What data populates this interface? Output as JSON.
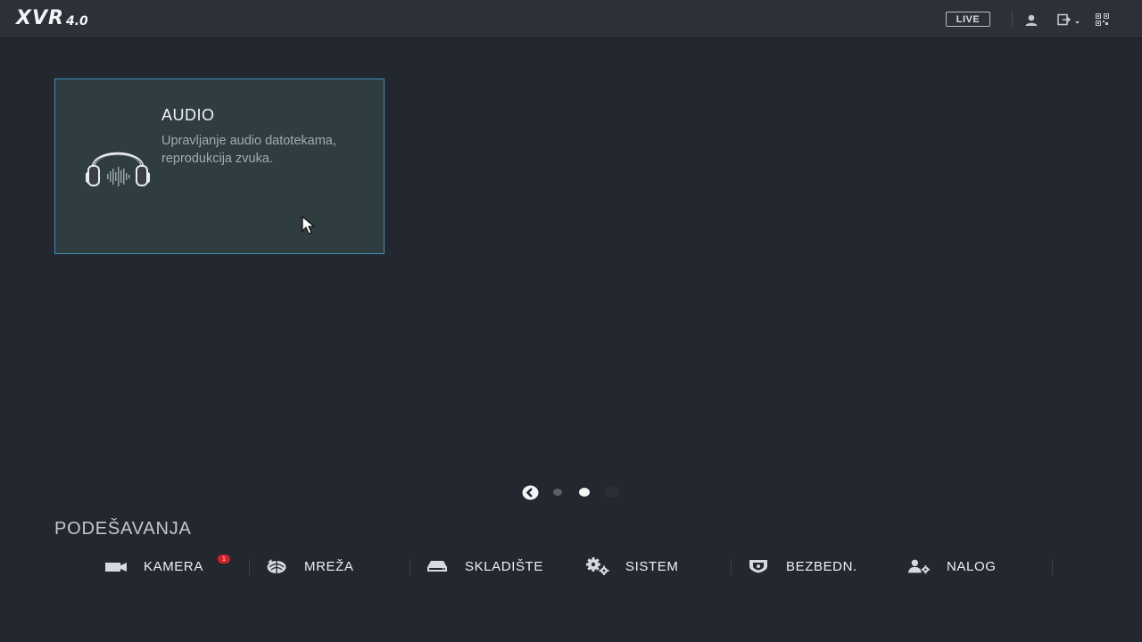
{
  "header": {
    "logo_main": "XVR",
    "logo_version": "4.0",
    "live_label": "LIVE",
    "icons": [
      "user-icon",
      "logout-icon",
      "qr-code-icon"
    ]
  },
  "card": {
    "title": "AUDIO",
    "description": "Upravljanje audio datotekama, reprodukcija zvuka.",
    "icon": "headphones-icon"
  },
  "pager": {
    "pages": 3,
    "current": 2
  },
  "section": {
    "title": "PODEŠAVANJA"
  },
  "menu": {
    "items": [
      {
        "label": "KAMERA",
        "icon": "camera-icon",
        "badge": "1"
      },
      {
        "label": "MREŽA",
        "icon": "network-icon"
      },
      {
        "label": "SKLADIŠTE",
        "icon": "storage-icon"
      },
      {
        "label": "SISTEM",
        "icon": "gears-icon"
      },
      {
        "label": "BEZBEDN.",
        "icon": "shield-icon"
      },
      {
        "label": "NALOG",
        "icon": "account-settings-icon"
      }
    ]
  },
  "colors": {
    "background": "#232830",
    "card_bg": "#2f3c40",
    "card_border": "#3f8fb4",
    "badge": "#d6202a"
  }
}
